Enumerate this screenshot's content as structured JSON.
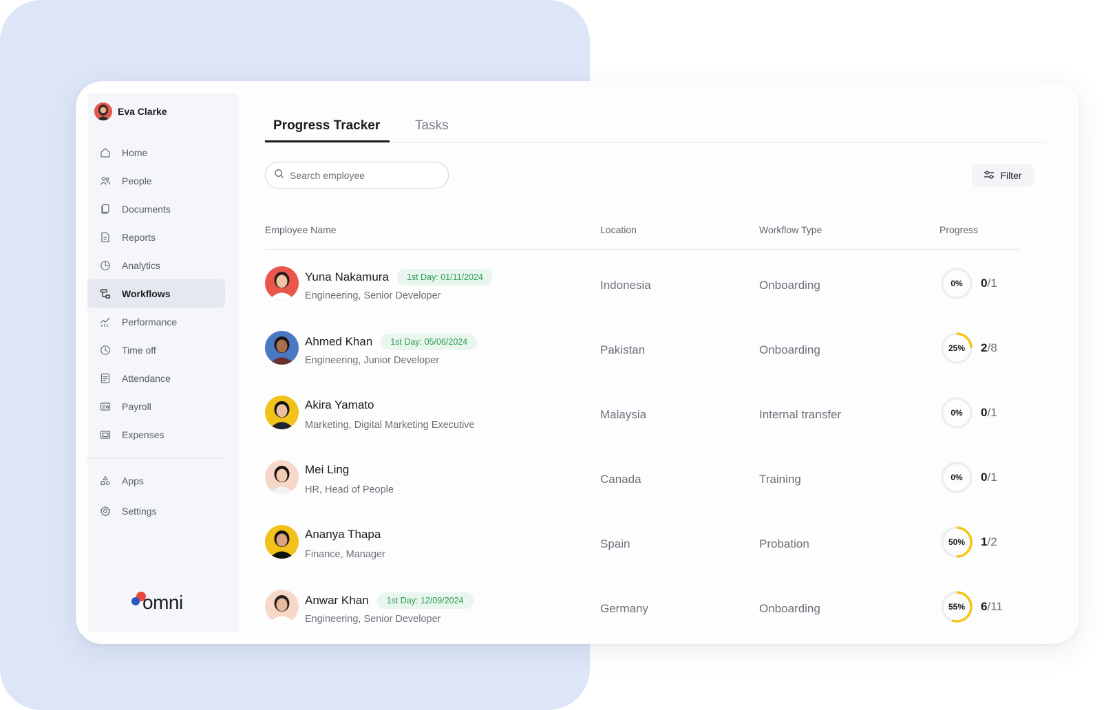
{
  "user": {
    "name": "Eva Clarke"
  },
  "sidebar": {
    "items": [
      {
        "label": "Home",
        "icon": "home-icon",
        "active": false
      },
      {
        "label": "People",
        "icon": "people-icon",
        "active": false
      },
      {
        "label": "Documents",
        "icon": "documents-icon",
        "active": false
      },
      {
        "label": "Reports",
        "icon": "reports-icon",
        "active": false
      },
      {
        "label": "Analytics",
        "icon": "analytics-icon",
        "active": false
      },
      {
        "label": "Workflows",
        "icon": "workflows-icon",
        "active": true
      },
      {
        "label": "Performance",
        "icon": "performance-icon",
        "active": false
      },
      {
        "label": "Time off",
        "icon": "clock-icon",
        "active": false
      },
      {
        "label": "Attendance",
        "icon": "attendance-icon",
        "active": false
      },
      {
        "label": "Payroll",
        "icon": "payroll-icon",
        "active": false
      },
      {
        "label": "Expenses",
        "icon": "expenses-icon",
        "active": false
      }
    ],
    "lower_items": [
      {
        "label": "Apps",
        "icon": "apps-icon"
      },
      {
        "label": "Settings",
        "icon": "gear-icon"
      }
    ],
    "logo_text": "omni"
  },
  "tabs": [
    {
      "label": "Progress Tracker",
      "active": true
    },
    {
      "label": "Tasks",
      "active": false
    }
  ],
  "search": {
    "placeholder": "Search employee",
    "value": ""
  },
  "filter_label": "Filter",
  "table": {
    "columns": [
      "Employee Name",
      "Location",
      "Workflow Type",
      "Progress"
    ],
    "rows": [
      {
        "name": "Yuna Nakamura",
        "badge": "1st Day: 01/11/2024",
        "role": "Engineering, Senior Developer",
        "location": "Indonesia",
        "workflow": "Onboarding",
        "percent_label": "0%",
        "percent": 0,
        "done": "0",
        "total": "/1"
      },
      {
        "name": "Ahmed Khan",
        "badge": "1st Day: 05/06/2024",
        "role": "Engineering, Junior Developer",
        "location": "Pakistan",
        "workflow": "Onboarding",
        "percent_label": "25%",
        "percent": 25,
        "done": "2",
        "total": "/8"
      },
      {
        "name": "Akira Yamato",
        "badge": "",
        "role": "Marketing, Digital Marketing Executive",
        "location": "Malaysia",
        "workflow": "Internal transfer",
        "percent_label": "0%",
        "percent": 0,
        "done": "0",
        "total": "/1"
      },
      {
        "name": "Mei Ling",
        "badge": "",
        "role": "HR, Head of People",
        "location": "Canada",
        "workflow": "Training",
        "percent_label": "0%",
        "percent": 0,
        "done": "0",
        "total": "/1"
      },
      {
        "name": "Ananya Thapa",
        "badge": "",
        "role": "Finance, Manager",
        "location": "Spain",
        "workflow": "Probation",
        "percent_label": "50%",
        "percent": 50,
        "done": "1",
        "total": "/2"
      },
      {
        "name": "Anwar Khan",
        "badge": "1st Day: 12/09/2024",
        "role": "Engineering, Senior Developer",
        "location": "Germany",
        "workflow": "Onboarding",
        "percent_label": "55%",
        "percent": 55,
        "done": "6",
        "total": "/11"
      }
    ]
  },
  "colors": {
    "background_blob": "#dce6f7",
    "progress_ring": "#f5c518",
    "progress_track": "#eceef1",
    "badge_text": "#2d9a55",
    "badge_bg": "#e9f6ee",
    "logo_red": "#e9473d",
    "logo_blue": "#2d56c4"
  }
}
